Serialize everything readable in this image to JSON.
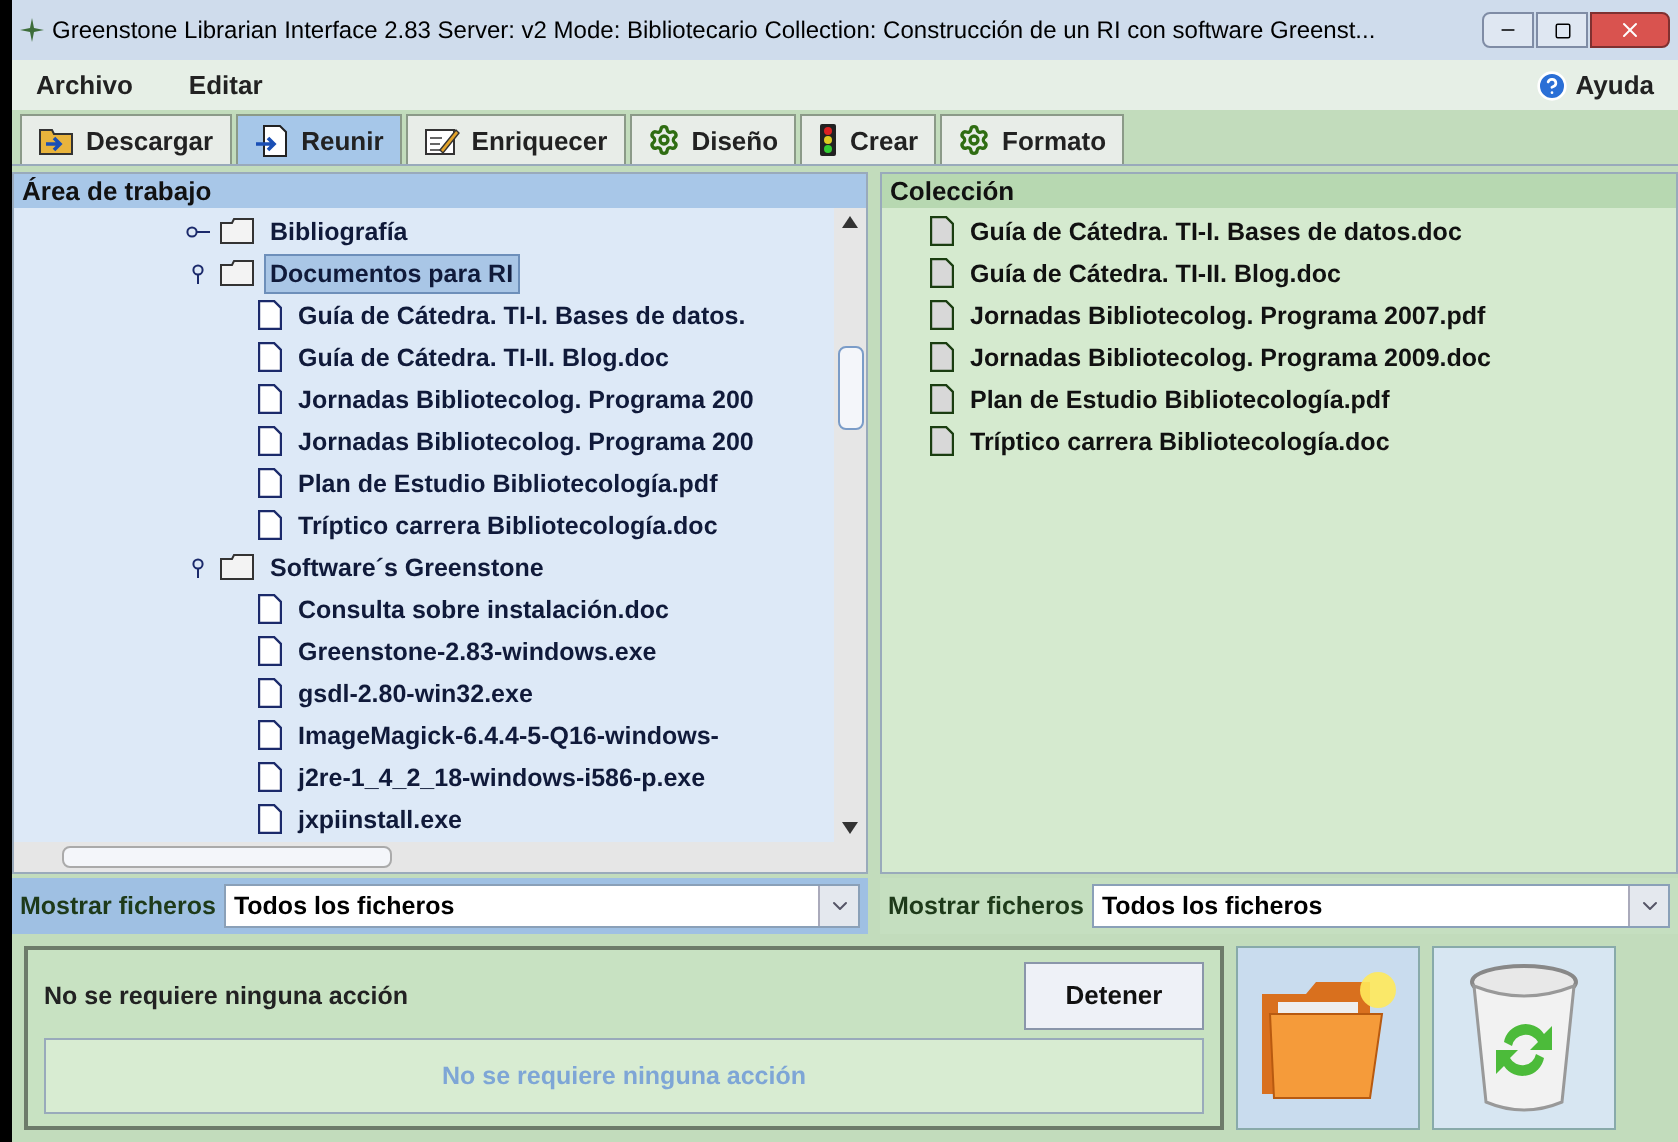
{
  "window": {
    "title": "Greenstone Librarian Interface 2.83  Server: v2  Mode: Bibliotecario  Collection: Construcción de un RI con software Greenst..."
  },
  "menu": [
    "Archivo",
    "Editar"
  ],
  "help": "Ayuda",
  "tabs": [
    {
      "label": "Descargar",
      "selected": false
    },
    {
      "label": "Reunir",
      "selected": true
    },
    {
      "label": "Enriquecer",
      "selected": false
    },
    {
      "label": "Diseño",
      "selected": false
    },
    {
      "label": "Crear",
      "selected": false
    },
    {
      "label": "Formato",
      "selected": false
    }
  ],
  "workspace": {
    "title": "Área de trabajo",
    "tree": [
      {
        "label": "Bibliografía",
        "kind": "folder",
        "expanded": false,
        "selected": false
      },
      {
        "label": "Documentos para RI",
        "kind": "folder",
        "expanded": true,
        "selected": true,
        "children": [
          {
            "label": "Guía de Cátedra. TI-I. Bases de datos.",
            "kind": "file",
            "selected": false
          },
          {
            "label": "Guía de Cátedra. TI-II. Blog.doc",
            "kind": "file",
            "selected": false
          },
          {
            "label": "Jornadas Bibliotecolog. Programa 200",
            "kind": "file",
            "selected": false
          },
          {
            "label": "Jornadas Bibliotecolog. Programa 200",
            "kind": "file",
            "selected": false
          },
          {
            "label": "Plan de Estudio Bibliotecología.pdf",
            "kind": "file",
            "selected": false
          },
          {
            "label": "Tríptico carrera Bibliotecología.doc",
            "kind": "file",
            "selected": false
          }
        ]
      },
      {
        "label": "Software´s Greenstone",
        "kind": "folder",
        "expanded": true,
        "selected": false,
        "children": [
          {
            "label": "Consulta sobre instalación.doc",
            "kind": "file",
            "selected": false
          },
          {
            "label": "Greenstone-2.83-windows.exe",
            "kind": "file",
            "selected": false
          },
          {
            "label": "gsdl-2.80-win32.exe",
            "kind": "file",
            "selected": false
          },
          {
            "label": "ImageMagick-6.4.4-5-Q16-windows-",
            "kind": "file",
            "selected": false
          },
          {
            "label": "j2re-1_4_2_18-windows-i586-p.exe",
            "kind": "file",
            "selected": false
          },
          {
            "label": "jxpiinstall.exe",
            "kind": "file",
            "selected": false
          }
        ]
      }
    ],
    "filter": {
      "label": "Mostrar ficheros",
      "value": "Todos los ficheros"
    }
  },
  "collection": {
    "title": "Colección",
    "files": [
      {
        "label": "Guía de Cátedra. TI-I. Bases de datos.doc",
        "selected": false
      },
      {
        "label": "Guía de Cátedra. TI-II. Blog.doc",
        "selected": false
      },
      {
        "label": "Jornadas Bibliotecolog. Programa 2007.pdf",
        "selected": false
      },
      {
        "label": "Jornadas Bibliotecolog. Programa 2009.doc",
        "selected": false
      },
      {
        "label": "Plan de Estudio Bibliotecología.pdf",
        "selected": false
      },
      {
        "label": "Tríptico carrera Bibliotecología.doc",
        "selected": false
      }
    ],
    "filter": {
      "label": "Mostrar ficheros",
      "value": "Todos los ficheros"
    }
  },
  "status": {
    "message": "No se requiere ninguna acción",
    "stop_button": "Detener",
    "progress_text": "No se requiere ninguna acción",
    "level": 0
  }
}
